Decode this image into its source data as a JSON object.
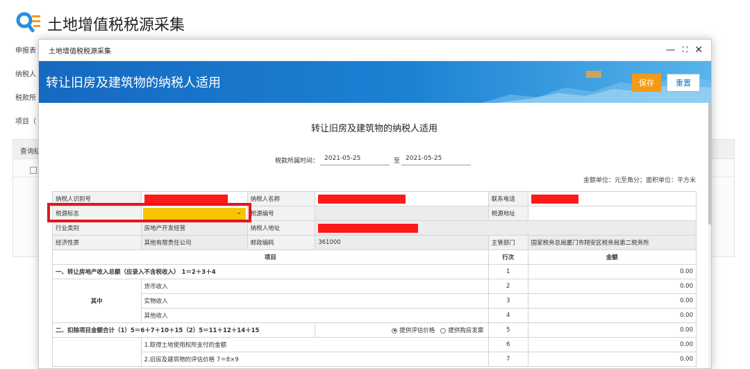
{
  "app": {
    "title": "土地增值税税源采集",
    "bg_rows": [
      "申报表",
      "纳税人",
      "税款所",
      "项目（"
    ],
    "bg_query_label": "查询结"
  },
  "modal": {
    "window_title": "土地增值税税源采集",
    "minimize": "—",
    "maximize": "⛶",
    "close": "✕",
    "banner_title": "转让旧房及建筑物的纳税人适用",
    "save_label": "保存",
    "reset_label": "重置"
  },
  "form": {
    "title": "转让旧房及建筑物的纳税人适用",
    "period_label": "税款所属时间：",
    "period_start": "2021-05-25",
    "period_to": "至",
    "period_end": "2021-05-25",
    "unit_note": "金额单位：元至角分；面积单位：平方米"
  },
  "info": {
    "taxpayer_id_label": "纳税人识别号",
    "taxpayer_name_label": "纳税人名称",
    "phone_label": "联系电话",
    "source_flag_label": "税源标志",
    "source_no_label": "税源编号",
    "source_addr_label": "税源地址",
    "industry_label": "行业类别",
    "industry_value": "房地产开发经营",
    "taxpayer_addr_label": "纳税人地址",
    "econ_label": "经济性质",
    "econ_value": "其他有限责任公司",
    "postcode_label": "邮政编码",
    "postcode_value": "361000",
    "authority_label": "主管部门",
    "authority_value": "国家税务总局厦门市翔安区税务局第二税务所"
  },
  "table": {
    "col_item": "项目",
    "col_line": "行次",
    "col_amount": "金额",
    "row1_label": "一、转让房地产收入总额（应录入不含税收入） 1＝2＋3＋4",
    "row1_line": "1",
    "row1_amount": "0.00",
    "group_label": "其中",
    "row2_label": "货币收入",
    "row2_line": "2",
    "row2_amount": "0.00",
    "row3_label": "实物收入",
    "row3_line": "3",
    "row3_amount": "0.00",
    "row4_label": "其他收入",
    "row4_line": "4",
    "row4_amount": "0.00",
    "row5_label": "二、扣除项目金额合计（1）5＝6＋7＋10＋15（2）5＝11＋12＋14＋15",
    "row5_radio1": "提供评估价格",
    "row5_radio2": "提供购房发票",
    "row5_line": "5",
    "row5_amount": "0.00",
    "row6_label": "1.取得土地使用权所支付的金额",
    "row6_line": "6",
    "row6_amount": "0.00",
    "row7_label": "2.旧房及建筑物的评估价格 7＝8×9",
    "row7_line": "7",
    "row7_amount": "0.00"
  },
  "colors": {
    "banner": "#1b82d4",
    "save_button": "#f39a18",
    "highlight": "#e4161c",
    "select_fill": "#f7c600",
    "redaction": "#ff1a1a"
  }
}
